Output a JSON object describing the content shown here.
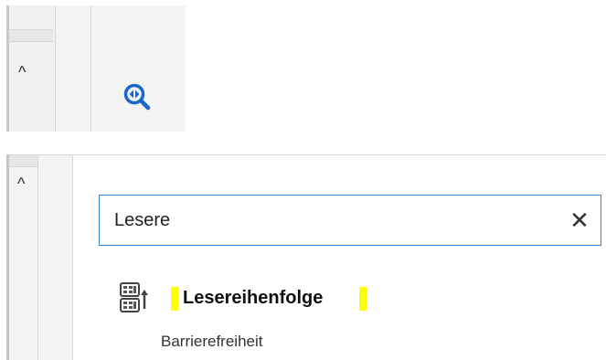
{
  "top_toolbar": {
    "collapse_caret": "^",
    "tool_icon": "zoom-icon",
    "accent_color": "#1a66c8"
  },
  "search": {
    "collapse_caret": "^",
    "query": "Lesere",
    "clear_label": "✕",
    "border_color": "#2f7fd0"
  },
  "results": [
    {
      "title": "Lesereihenfolge",
      "category": "Barrierefreiheit",
      "icon": "reading-order-icon",
      "highlight_color": "#ffff00"
    }
  ]
}
